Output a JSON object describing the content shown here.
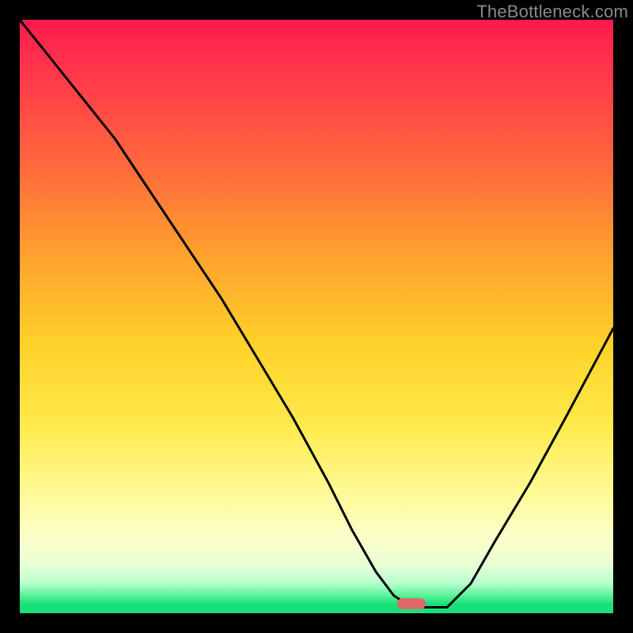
{
  "watermark": {
    "text": "TheBottleneck.com"
  },
  "chart_data": {
    "type": "line",
    "title": "",
    "xlabel": "",
    "ylabel": "",
    "xlim": [
      0,
      100
    ],
    "ylim": [
      0,
      100
    ],
    "grid": false,
    "curve_color": "#000000",
    "series": [
      {
        "name": "bottleneck-curve",
        "x": [
          0,
          8,
          16,
          24,
          28,
          34,
          40,
          46,
          52,
          56,
          60,
          63,
          66,
          68,
          72,
          76,
          80,
          86,
          92,
          100
        ],
        "y": [
          100,
          90,
          80,
          68,
          62,
          53,
          43,
          33,
          22,
          14,
          7,
          3,
          1,
          1,
          1,
          5,
          12,
          22,
          33,
          48
        ]
      }
    ],
    "marker": {
      "x": 66,
      "y": 1.6,
      "shape": "rounded-rect",
      "color": "#e06868"
    },
    "background_gradient": {
      "direction": "vertical",
      "stops": [
        {
          "pct": 0,
          "color": "#ff1a4d"
        },
        {
          "pct": 25,
          "color": "#ff6a3c"
        },
        {
          "pct": 55,
          "color": "#ffd22a"
        },
        {
          "pct": 80,
          "color": "#fbffc8"
        },
        {
          "pct": 97,
          "color": "#5bf296"
        },
        {
          "pct": 100,
          "color": "#18e07a"
        }
      ]
    }
  }
}
